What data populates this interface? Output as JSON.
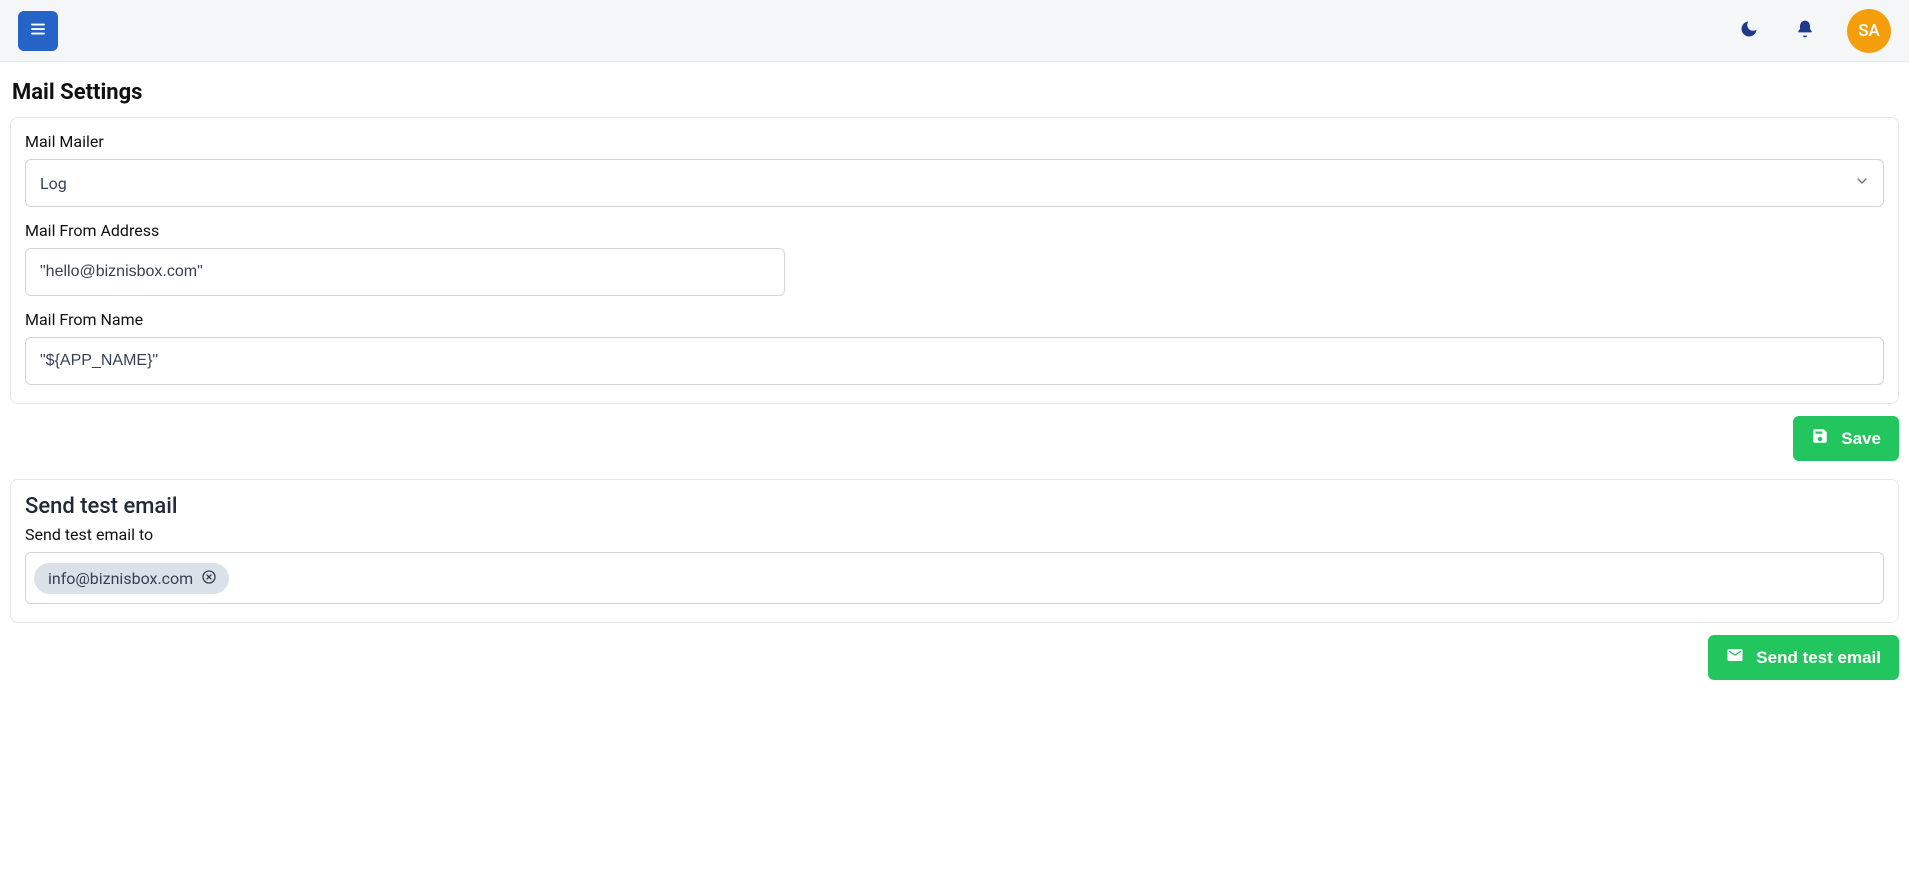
{
  "header": {
    "avatar_initials": "SA"
  },
  "page": {
    "title": "Mail Settings"
  },
  "form": {
    "mailer_label": "Mail Mailer",
    "mailer_value": "Log",
    "from_address_label": "Mail From Address",
    "from_address_value": "\"hello@biznisbox.com\"",
    "from_name_label": "Mail From Name",
    "from_name_value": "\"${APP_NAME}\""
  },
  "actions": {
    "save_label": "Save",
    "send_test_label": "Send test email"
  },
  "test_email": {
    "section_title": "Send test email",
    "field_label": "Send test email to",
    "chips": [
      "info@biznisbox.com"
    ]
  }
}
